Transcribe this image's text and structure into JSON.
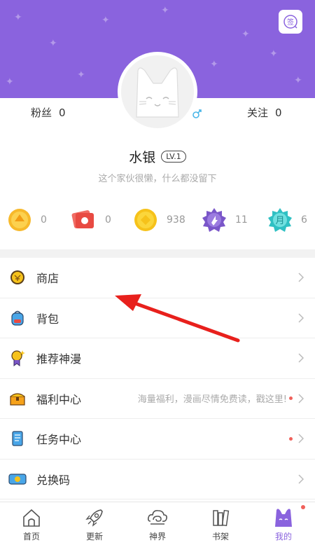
{
  "profile": {
    "username": "水银",
    "level": "LV.1",
    "bio": "这个家伙很懒，什么都没留下",
    "fans_label": "粉丝",
    "fans_count": "0",
    "follow_label": "关注",
    "follow_count": "0",
    "sign_in_label": "签"
  },
  "assets": [
    {
      "icon": "gold-coin-icon",
      "value": "0"
    },
    {
      "icon": "red-ticket-icon",
      "value": "0"
    },
    {
      "icon": "yellow-coin-icon",
      "value": "938"
    },
    {
      "icon": "purple-badge-icon",
      "value": "11"
    },
    {
      "icon": "monthly-ticket-icon",
      "value": "6",
      "badge_text": "月"
    }
  ],
  "menu": [
    {
      "label": "商店",
      "icon": "shop-coin-icon"
    },
    {
      "label": "背包",
      "icon": "backpack-icon"
    },
    {
      "label": "推荐神漫",
      "icon": "medal-icon"
    },
    {
      "label": "福利中心",
      "icon": "treasure-chest-icon",
      "hint": "海量福利，漫画尽情免费读，戳这里!",
      "dot": true
    },
    {
      "label": "任务中心",
      "icon": "scroll-icon",
      "dot": true
    },
    {
      "label": "兑换码",
      "icon": "coupon-icon"
    }
  ],
  "tabs": [
    {
      "label": "首页",
      "icon": "home-icon"
    },
    {
      "label": "更新",
      "icon": "rocket-icon"
    },
    {
      "label": "神界",
      "icon": "cloud-swirl-icon"
    },
    {
      "label": "书架",
      "icon": "bookshelf-icon"
    },
    {
      "label": "我的",
      "icon": "profile-icon",
      "active": true
    }
  ],
  "colors": {
    "accent": "#8a63de",
    "notification_dot": "#f0605a",
    "annotation_arrow": "#e8201c"
  }
}
